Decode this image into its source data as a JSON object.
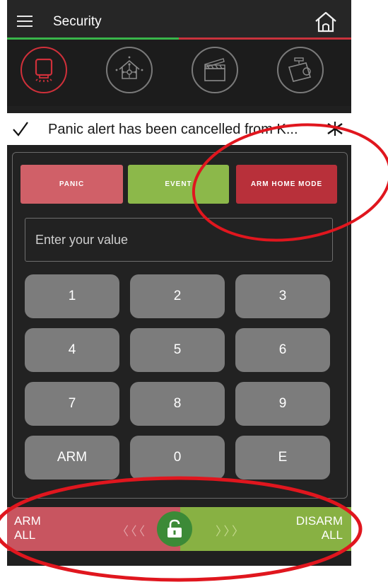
{
  "header": {
    "title": "Security",
    "accent_colors": [
      "#39b54a",
      "#c8323c"
    ]
  },
  "tabs": [
    {
      "icon": "panic-sensor-icon",
      "active": true
    },
    {
      "icon": "smart-home-icon",
      "active": false
    },
    {
      "icon": "clapperboard-icon",
      "active": false
    },
    {
      "icon": "security-camera-icon",
      "active": false
    }
  ],
  "notification": {
    "icon": "check-icon",
    "text": "Panic alert has been cancelled from K..."
  },
  "actions": {
    "panic": "PANIC",
    "events": "EVENT",
    "arm_home": "ARM HOME MODE"
  },
  "input": {
    "placeholder": "Enter your value",
    "value": ""
  },
  "keypad": [
    "1",
    "2",
    "3",
    "4",
    "5",
    "6",
    "7",
    "8",
    "9",
    "ARM",
    "0",
    "E"
  ],
  "slider": {
    "left_line1": "ARM",
    "left_line2": "ALL",
    "right_line1": "DISARM",
    "right_line2": "ALL",
    "left_chevrons": "〈〈〈",
    "right_chevrons": "〉〉〉",
    "knob_icon": "unlocked-padlock-icon"
  },
  "colors": {
    "panic": "#d06068",
    "events": "#8cb84a",
    "arm_home": "#b8303a",
    "key": "#7c7c7c",
    "slider_arm": "#c85560",
    "slider_disarm": "#88b143",
    "knob": "#3c8a37",
    "annotation": "#e0161e"
  }
}
